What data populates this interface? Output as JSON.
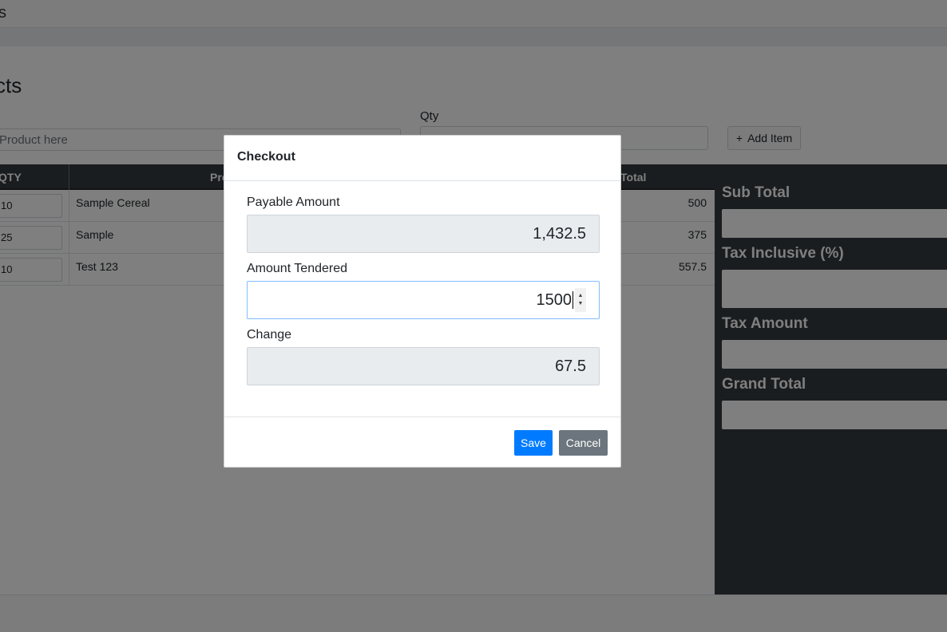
{
  "app": {
    "brand_fragment": "s"
  },
  "page": {
    "title_fragment": "cts"
  },
  "form": {
    "product_placeholder": "Product here",
    "qty_label": "Qty",
    "add_item_label": "Add Item"
  },
  "table": {
    "headers": {
      "qty": "QTY",
      "product": "Pro",
      "total": "Total"
    },
    "rows": [
      {
        "qty": "10",
        "product": "Sample Cereal",
        "total": "500"
      },
      {
        "qty": "25",
        "product": "Sample",
        "total": "375"
      },
      {
        "qty": "10",
        "product": "Test 123",
        "total": "557.5"
      }
    ]
  },
  "summary": {
    "sub_total_label": "Sub Total",
    "tax_inclusive_label": "Tax Inclusive (%)",
    "tax_amount_label": "Tax Amount",
    "grand_total_label": "Grand Total"
  },
  "modal": {
    "title": "Checkout",
    "payable_label": "Payable Amount",
    "payable_value": "1,432.5",
    "tendered_label": "Amount Tendered",
    "tendered_value": "1500",
    "change_label": "Change",
    "change_value": "67.5",
    "save_label": "Save",
    "cancel_label": "Cancel"
  },
  "colors": {
    "primary": "#007bff",
    "secondary": "#6c757d",
    "dark": "#343a40"
  }
}
